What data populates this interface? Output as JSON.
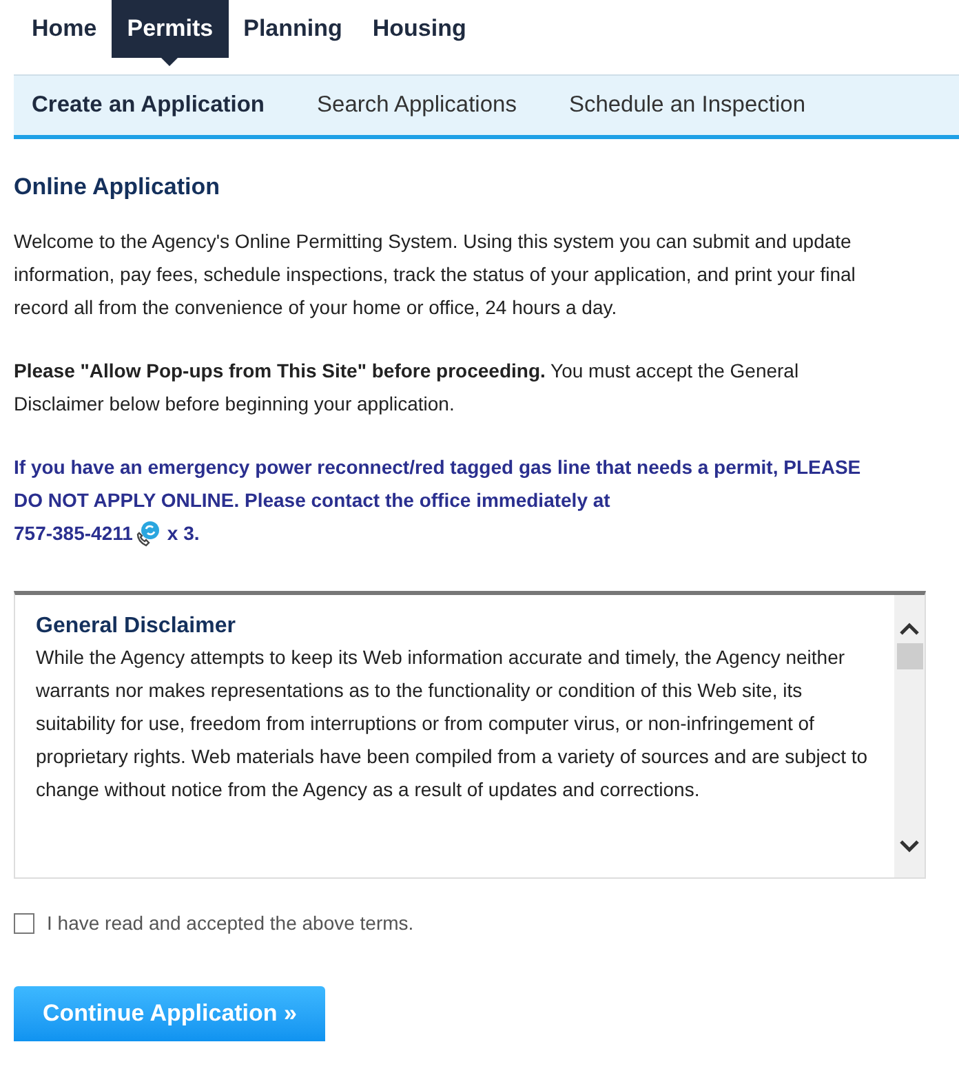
{
  "top_nav": [
    {
      "label": "Home",
      "selected": false
    },
    {
      "label": "Permits",
      "selected": true
    },
    {
      "label": "Planning",
      "selected": false
    },
    {
      "label": "Housing",
      "selected": false
    }
  ],
  "sub_nav": [
    {
      "label": "Create an Application",
      "selected": true
    },
    {
      "label": "Search Applications",
      "selected": false
    },
    {
      "label": "Schedule an Inspection",
      "selected": false
    }
  ],
  "heading": "Online Application",
  "welcome": "Welcome to the Agency's Online Permitting System. Using this system you can submit and update information, pay fees, schedule inspections, track the status of your application, and print your final record all from the convenience of your home or office, 24 hours a day.",
  "popups": "**Please \"Allow Pop-ups from This Site\" before proceeding.** You must accept the General Disclaimer below before beginning your application.",
  "emergency": {
    "text": "If you have an emergency power reconnect/red tagged gas line that needs a permit, PLEASE DO NOT APPLY ONLINE.  Please contact the office immediately at",
    "phone": "757-385-4211",
    "suffix": "x 3."
  },
  "disclaimer": {
    "title": "General Disclaimer",
    "body": "While the Agency attempts to keep its Web information accurate and timely, the Agency neither warrants nor makes representations as to the functionality or condition of this Web site, its suitability for use, freedom from interruptions or from computer virus, or non-infringement of proprietary rights. Web materials have been compiled from a variety of sources and are subject to change without notice from the Agency as a result of updates and corrections."
  },
  "accept": {
    "label": "I have read and accepted the above terms.",
    "checked": false
  },
  "continue_button": "Continue Application »"
}
